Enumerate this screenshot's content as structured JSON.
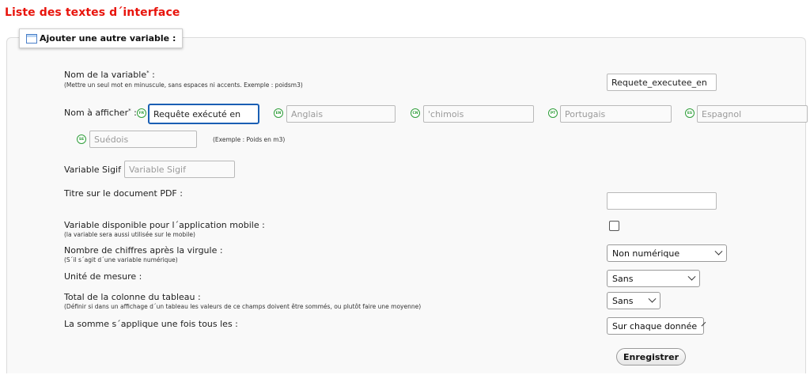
{
  "page": {
    "title": "Liste des textes d´interface"
  },
  "form": {
    "legend": "Ajouter une autre variable :",
    "variable_name": {
      "label": "Nom de la variable",
      "required_mark": "*",
      "colon": " :",
      "hint": "(Mettre un seul mot en minuscule, sans espaces ni accents. Exemple : poidsm3)",
      "value": "Requete_executee_en"
    },
    "display_name": {
      "label": "Nom à afficher",
      "required_mark": "*",
      "colon": " :",
      "example": "(Exemple : Poids en m3)",
      "languages": [
        {
          "code": "FR",
          "value": "Requête exécuté en",
          "placeholder": ""
        },
        {
          "code": "EN",
          "value": "",
          "placeholder": "Anglais"
        },
        {
          "code": "CN",
          "value": "",
          "placeholder": "'chimois"
        },
        {
          "code": "PT",
          "value": "",
          "placeholder": "Portugais"
        },
        {
          "code": "ES",
          "value": "",
          "placeholder": "Espagnol"
        },
        {
          "code": "SE",
          "value": "",
          "placeholder": "Suédois"
        }
      ]
    },
    "sigif": {
      "label": "Variable Sigif :",
      "placeholder": "Variable Sigif"
    },
    "pdf_title": {
      "label": "Titre sur le document PDF :",
      "value": ""
    },
    "mobile": {
      "label": "Variable disponible pour l´application mobile :",
      "hint": "(la variable sera aussi utilisée sur le mobile)",
      "checked": false
    },
    "decimals": {
      "label": "Nombre de chiffres après la virgule :",
      "hint": "(S´il s´agit d´une variable numérique)",
      "selected": "Non numérique"
    },
    "unit": {
      "label": "Unité de mesure :",
      "selected": "Sans"
    },
    "column_total": {
      "label": "Total de la colonne du tableau :",
      "hint": "(Définir si dans un affichage d´un tableau les valeurs de ce champs doivent être sommés, ou plutôt faire une moyenne)",
      "selected": "Sans"
    },
    "sum_applies": {
      "label": "La somme s´applique une fois tous les :",
      "selected": "Sur chaque donnée"
    },
    "save_label": "Enregistrer"
  },
  "colors": {
    "title": "#e8140c",
    "focus": "#1a5fb4",
    "flag": "#2f9e3a"
  }
}
